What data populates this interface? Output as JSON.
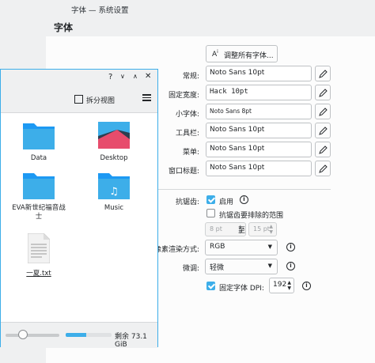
{
  "window": {
    "title": "字体 — 系统设置"
  },
  "page": {
    "heading": "字体"
  },
  "adjust_all_label": "调整所有字体...",
  "font_rows": [
    {
      "label": "常规:",
      "value": "Noto Sans 10pt"
    },
    {
      "label": "固定宽度:",
      "value": "Hack 10pt"
    },
    {
      "label": "小字体:",
      "value": "Noto Sans 8pt"
    },
    {
      "label": "工具栏:",
      "value": "Noto Sans 10pt"
    },
    {
      "label": "菜单:",
      "value": "Noto Sans 10pt"
    },
    {
      "label": "窗口标题:",
      "value": "Noto Sans 10pt"
    }
  ],
  "antialias": {
    "label": "抗锯齿:",
    "enabled_label": "启用",
    "enabled": true,
    "exclude_label": "抗锯齿要排除的范围",
    "exclude": false,
    "from": "8 pt",
    "to_label": "至",
    "to": "15 pt"
  },
  "subpixel": {
    "label": "像素渲染方式:",
    "value": "RGB"
  },
  "hinting": {
    "label": "微调:",
    "value": "轻微"
  },
  "dpi": {
    "label": "固定字体 DPI:",
    "value": "192",
    "enabled": true
  },
  "dolphin": {
    "split_label": "拆分视图",
    "files": [
      {
        "name": "Data",
        "type": "folder"
      },
      {
        "name": "Desktop",
        "type": "desktop"
      },
      {
        "name": "EVA新世纪福音战士",
        "type": "folder"
      },
      {
        "name": "Music",
        "type": "music"
      },
      {
        "name": "一夏.txt",
        "type": "text"
      }
    ],
    "free_space": "剩余 73.1 GiB"
  },
  "colors": {
    "accent": "#3daee9",
    "folder": "#3daee9"
  }
}
